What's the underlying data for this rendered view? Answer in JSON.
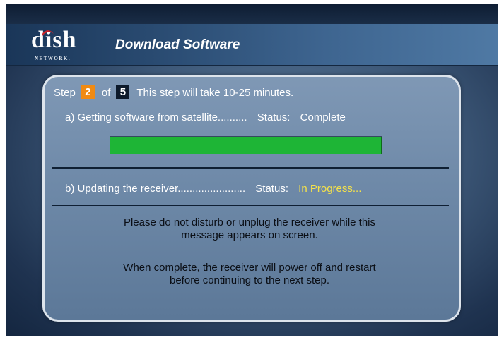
{
  "logo": {
    "word": "dish",
    "subtext": "NETWORK."
  },
  "header": {
    "title": "Download Software"
  },
  "step": {
    "label": "Step",
    "current": "2",
    "of_label": "of",
    "total": "5",
    "duration_text": "This step will take 10-25 minutes."
  },
  "task_a": {
    "label": "a) Getting software from satellite..........",
    "status_label": "Status:",
    "status_value": "Complete",
    "progress_fraction": 1.0
  },
  "task_b": {
    "label": "b) Updating the receiver.......................",
    "status_label": "Status:",
    "status_value": "In Progress..."
  },
  "messages": {
    "warning_line1": "Please do not disturb or unplug the receiver while this",
    "warning_line2": "message appears on screen.",
    "info_line1": "When complete, the receiver will power off and restart",
    "info_line2": "before continuing to the next step."
  },
  "colors": {
    "progress_fill": "#1eb536",
    "in_progress_status": "#f5e24a",
    "current_step_badge": "#f08a12",
    "total_step_badge": "#0d1a2b"
  }
}
